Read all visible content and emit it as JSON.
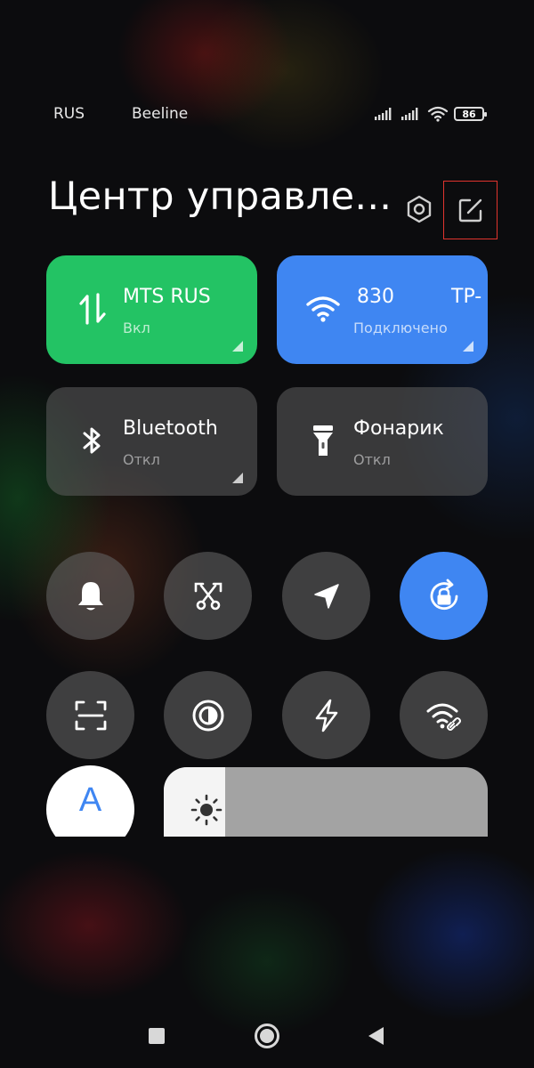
{
  "status_bar": {
    "carrier_1": "RUS",
    "carrier_2": "Beeline",
    "battery_level": "86"
  },
  "header": {
    "title": "Центр управле..."
  },
  "tiles": {
    "mobile_data": {
      "name": "MTS RUS",
      "state": "Вкл"
    },
    "wifi": {
      "name_part_1": "830",
      "name_part_2": "TP-",
      "state": "Подключено"
    },
    "bluetooth": {
      "name": "Bluetooth",
      "state": "Откл"
    },
    "flashlight": {
      "name": "Фонарик",
      "state": "Откл"
    }
  },
  "toggles": [
    {
      "icon": "bell-icon",
      "active": false
    },
    {
      "icon": "screenshot-scissors-icon",
      "active": false
    },
    {
      "icon": "location-arrow-icon",
      "active": false
    },
    {
      "icon": "rotation-lock-icon",
      "active": true
    },
    {
      "icon": "scanner-icon",
      "active": false
    },
    {
      "icon": "reading-mode-icon",
      "active": false
    },
    {
      "icon": "lightning-icon",
      "active": false
    },
    {
      "icon": "wifi-hotspot-icon",
      "active": false
    }
  ],
  "auto_brightness": {
    "label": "A"
  },
  "brightness": {
    "level": 0.19
  },
  "colors": {
    "mobile_tile": "#23c364",
    "wifi_tile": "#3f86f2",
    "active_toggle": "#3f86f2",
    "highlight_box": "#e0342e"
  }
}
